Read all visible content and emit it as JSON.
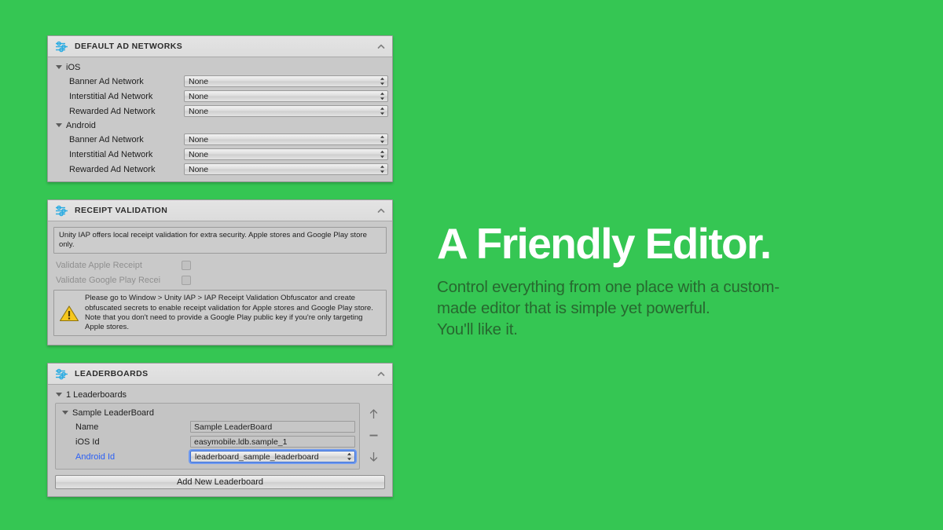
{
  "theme": {
    "background_color": "#35c653",
    "panel_body_color": "#c9c9c9",
    "panel_header_color": "#dedede",
    "accent_link_color": "#2a5ff5",
    "promo_title_color": "#ffffff",
    "promo_body_color": "#27682f",
    "icon_color": "#29abe2",
    "warning_color": "#f4c01e"
  },
  "panels": [
    {
      "id": "default-ad-networks",
      "icon": "sliders-icon",
      "title": "DEFAULT AD NETWORKS",
      "collapse_icon": "chevron-up-icon",
      "groups": [
        {
          "label": "iOS",
          "rows": [
            {
              "label": "Banner Ad Network",
              "value": "None"
            },
            {
              "label": "Interstitial Ad Network",
              "value": "None"
            },
            {
              "label": "Rewarded Ad Network",
              "value": "None"
            }
          ]
        },
        {
          "label": "Android",
          "rows": [
            {
              "label": "Banner Ad Network",
              "value": "None"
            },
            {
              "label": "Interstitial Ad Network",
              "value": "None"
            },
            {
              "label": "Rewarded Ad Network",
              "value": "None"
            }
          ]
        }
      ]
    },
    {
      "id": "receipt-validation",
      "icon": "sliders-icon",
      "title": "RECEIPT VALIDATION",
      "collapse_icon": "chevron-up-icon",
      "info_text": "Unity IAP offers local receipt validation for extra security. Apple stores and Google Play store only.",
      "checkboxes": [
        {
          "label": "Validate Apple Receipt",
          "checked": false
        },
        {
          "label": "Validate Google Play Recei",
          "checked": false
        }
      ],
      "warning_icon": "warning-triangle-icon",
      "warning_text": "Please go to Window > Unity IAP > IAP Receipt Validation Obfuscator and create obfuscated secrets to enable receipt validation for Apple stores and Google Play store. Note that you don't need to provide a Google Play public key if you're only targeting Apple stores."
    },
    {
      "id": "leaderboards",
      "icon": "sliders-icon",
      "title": "LEADERBOARDS",
      "collapse_icon": "chevron-up-icon",
      "count_label": "1 Leaderboards",
      "entry": {
        "title": "Sample LeaderBoard",
        "fields": [
          {
            "label": "Name",
            "value": "Sample LeaderBoard",
            "type": "text",
            "link": false,
            "focused": false
          },
          {
            "label": "iOS Id",
            "value": "easymobile.ldb.sample_1",
            "type": "text",
            "link": false,
            "focused": false
          },
          {
            "label": "Android Id",
            "value": "leaderboard_sample_leaderboard",
            "type": "popup",
            "link": true,
            "focused": true
          }
        ]
      },
      "side_buttons": [
        {
          "name": "move-up-button",
          "icon": "arrow-up-icon"
        },
        {
          "name": "remove-button",
          "icon": "minus-icon"
        },
        {
          "name": "move-down-button",
          "icon": "arrow-down-icon"
        }
      ],
      "add_button_label": "Add New Leaderboard"
    }
  ],
  "promo": {
    "title": "A Friendly Editor.",
    "body_line1": "Control everything from one place with a custom-",
    "body_line2": "made editor that is simple yet powerful.",
    "body_line3": "You'll like it."
  }
}
